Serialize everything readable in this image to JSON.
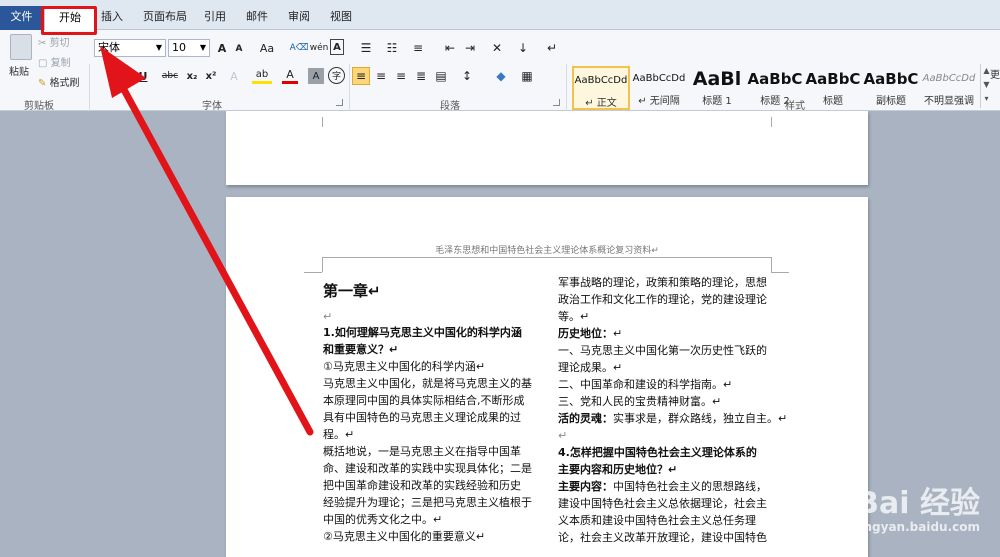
{
  "tabs": {
    "file": "文件",
    "home": "开始",
    "items": [
      "插入",
      "页面布局",
      "引用",
      "邮件",
      "审阅",
      "视图"
    ]
  },
  "clipboard": {
    "paste": "粘贴",
    "cut": "剪切",
    "copy": "复制",
    "format_painter": "格式刷",
    "label": "剪贴板"
  },
  "font": {
    "name": "宋体",
    "size": "10",
    "label": "字体",
    "grow": "A",
    "shrink": "A",
    "case": "Aa",
    "pinyin": "wén",
    "border_char": "A",
    "underline": "U",
    "strike": "abc",
    "sub": "x₂",
    "sup": "x²",
    "effects": "A",
    "highlight": "ab",
    "color": "A",
    "shade": "A",
    "enclose": "字"
  },
  "paragraph": {
    "label": "段落"
  },
  "styles": {
    "label": "样式",
    "items": [
      {
        "sample": "AaBbCcDd",
        "name": "↵ 正文"
      },
      {
        "sample": "AaBbCcDd",
        "name": "↵ 无间隔"
      },
      {
        "sample": "AaBl",
        "name": "标题 1"
      },
      {
        "sample": "AaBbC",
        "name": "标题 2"
      },
      {
        "sample": "AaBbC",
        "name": "标题"
      },
      {
        "sample": "AaBbC",
        "name": "副标题"
      },
      {
        "sample": "AaBbCcDd",
        "name": "不明显强调"
      }
    ],
    "more": "更"
  },
  "document": {
    "header": "毛泽东思想和中国特色社会主义理论体系概论复习资料↵",
    "left_col": {
      "chapter": "第一章↵",
      "blank": "↵",
      "q1_line1": "1.如何理解马克思主义中国化的科学内涵",
      "q1_line2": "和重要意义？↵",
      "p1": "①马克思主义中国化的科学内涵↵",
      "p2": "马克思主义中国化，就是将马克思主义的基",
      "p3": "本原理同中国的具体实际相结合,不断形成",
      "p4": "具有中国特色的马克思主义理论成果的过",
      "p5": "程。↵",
      "p6": "概括地说，一是马克思主义在指导中国革",
      "p7": "命、建设和改革的实践中实现具体化；二是",
      "p8": "把中国革命建设和改革的实践经验和历史",
      "p9": "经验提升为理论；三是把马克思主义植根于",
      "p10": "中国的优秀文化之中。↵",
      "p11": "②马克思主义中国化的重要意义↵"
    },
    "right_col": {
      "r1": "军事战略的理论，政策和策略的理论，思想",
      "r2": "政治工作和文化工作的理论，党的建设理论",
      "r3": "等。↵",
      "r4_bold": "历史地位：",
      "r4_rest": "↵",
      "r5": "一、马克思主义中国化第一次历史性飞跃的",
      "r6": "理论成果。↵",
      "r7": "二、中国革命和建设的科学指南。↵",
      "r8": "三、党和人民的宝贵精神财富。↵",
      "r9_bold": "活的灵魂：",
      "r9_rest": "实事求是，群众路线，独立自主。↵",
      "blank": "↵",
      "q4_line1": "4.怎样把握中国特色社会主义理论体系的",
      "q4_line2": "主要内容和历史地位？↵",
      "r10_bold": "主要内容：",
      "r10_rest": "中国特色社会主义的思想路线，",
      "r11": "建设中国特色社会主义总依据理论，社会主",
      "r12": "义本质和建设中国特色社会主义总任务理",
      "r13": "论，社会主义改革开放理论，建设中国特色"
    }
  },
  "watermark": {
    "brand": "Bai 经验",
    "url": "jingyan.baidu.com"
  },
  "colors": {
    "annotation": "#e1141a",
    "file_tab": "#2b579a"
  }
}
